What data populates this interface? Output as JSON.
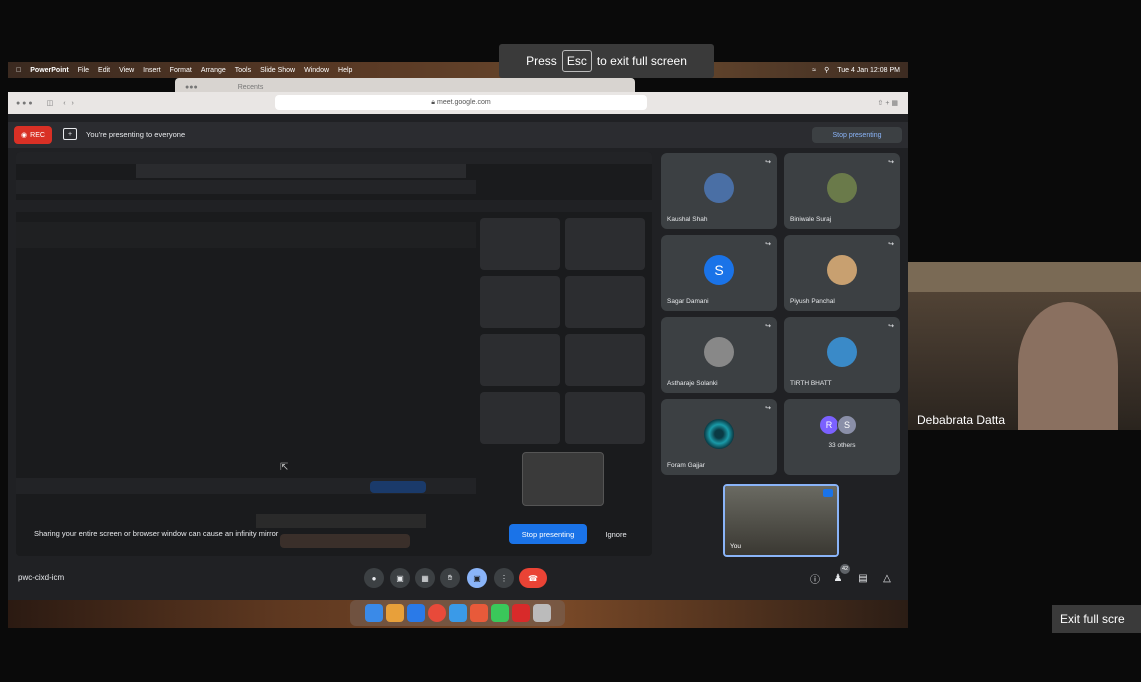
{
  "menubar": {
    "app": "PowerPoint",
    "items": [
      "File",
      "Edit",
      "View",
      "Insert",
      "Format",
      "Arrange",
      "Tools",
      "Slide Show",
      "Window",
      "Help"
    ],
    "datetime": "Tue 4 Jan 12:08 PM"
  },
  "esc_banner": {
    "press": "Press",
    "key": "Esc",
    "rest": "to exit full screen"
  },
  "finder": {
    "title": "Recents"
  },
  "browser": {
    "url": "meet.google.com"
  },
  "presenting_bar": {
    "rec": "REC",
    "message": "You're presenting to everyone",
    "stop": "Stop presenting"
  },
  "participants": [
    {
      "name": "Kaushal Shah",
      "type": "photo",
      "color": "#4a6fa5"
    },
    {
      "name": "Biniwale Suraj",
      "type": "photo",
      "color": "#6a7a4a"
    },
    {
      "name": "Sagar Damani",
      "type": "letter",
      "letter": "S",
      "color": "#1a73e8"
    },
    {
      "name": "Piyush Panchal",
      "type": "photo",
      "color": "#c8a070"
    },
    {
      "name": "Astharaje Solanki",
      "type": "photo",
      "color": "#888888"
    },
    {
      "name": "TIRTH BHATT",
      "type": "photo",
      "color": "#3a8ac8"
    },
    {
      "name": "Foram Gajjar",
      "type": "photo",
      "color": "#1a8a9a"
    }
  ],
  "others": {
    "letters": [
      "R",
      "S"
    ],
    "label": "33 others"
  },
  "self": {
    "name": "You"
  },
  "mirror_warning": {
    "text": "Sharing your entire screen or browser window can cause an infinity mirror",
    "stop": "Stop presenting",
    "ignore": "Ignore"
  },
  "meeting": {
    "code": "pwc-cixd-icm",
    "participant_count": "42"
  },
  "webcam": {
    "name": "Debabrata Datta"
  },
  "exit_fullscreen": "Exit full scre"
}
